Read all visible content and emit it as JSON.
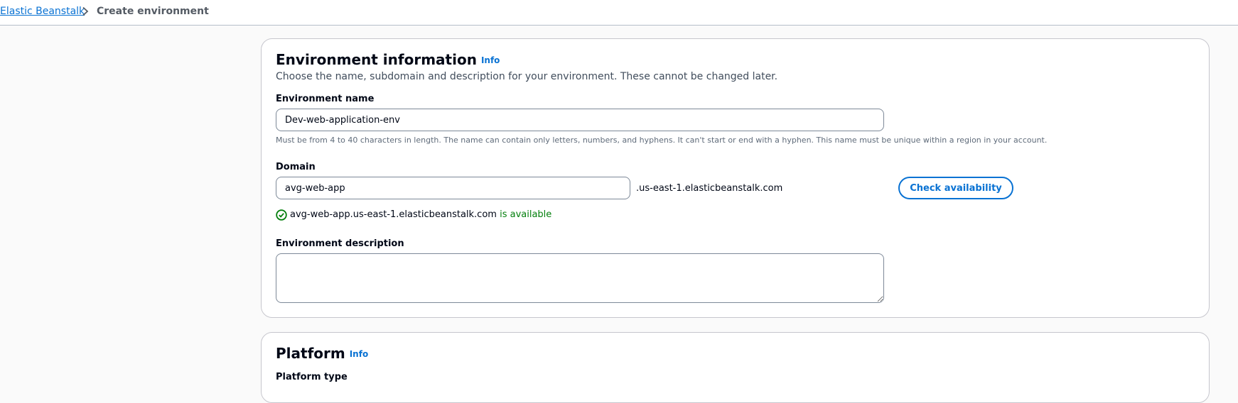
{
  "breadcrumb": {
    "parent": "Elastic Beanstalk",
    "current": "Create environment"
  },
  "env_info": {
    "title": "Environment information",
    "info": "Info",
    "description": "Choose the name, subdomain and description for your environment. These cannot be changed later.",
    "name": {
      "label": "Environment name",
      "value": "Dev-web-application-env",
      "hint": "Must be from 4 to 40 characters in length. The name can contain only letters, numbers, and hyphens. It can't start or end with a hyphen. This name must be unique within a region in your account."
    },
    "domain": {
      "label": "Domain",
      "value": "avg-web-app",
      "suffix": ".us-east-1.elasticbeanstalk.com",
      "check_button": "Check availability",
      "status_domain": "avg-web-app.us-east-1.elasticbeanstalk.com",
      "status_text": "is available"
    },
    "description_field": {
      "label": "Environment description",
      "value": ""
    }
  },
  "platform": {
    "title": "Platform",
    "info": "Info",
    "type_label": "Platform type"
  },
  "colors": {
    "link": "#0972d3",
    "success": "#037f0c",
    "border": "#7d8998"
  },
  "icons": {
    "separator": "chevron-right-icon",
    "status": "check-circle-icon"
  }
}
